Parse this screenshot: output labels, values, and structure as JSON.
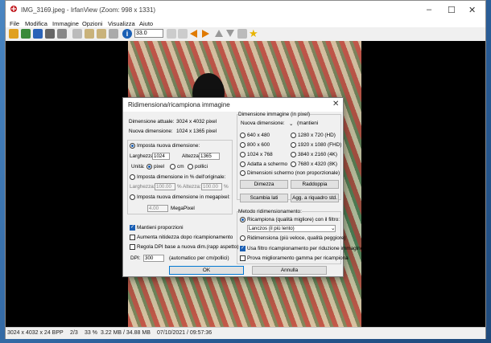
{
  "window": {
    "title": "IMG_3169.jpeg - IrfanView (Zoom: 998 x 1331)",
    "minimize": "–",
    "maximize": "☐",
    "close": "✕"
  },
  "menu": [
    "File",
    "Modifica",
    "Immagine",
    "Opzioni",
    "Visualizza",
    "Aiuto"
  ],
  "toolbar": {
    "zoom_value": "33.0",
    "icons": [
      "open-folder-icon",
      "slideshow-icon",
      "save-icon",
      "print-icon",
      "delete-icon",
      "cut-icon",
      "copy-icon",
      "paste-icon",
      "info-icon",
      "zoom-in-icon",
      "zoom-out-icon",
      "prev-icon",
      "next-icon",
      "first-icon",
      "last-icon",
      "tools-icon",
      "star-icon"
    ]
  },
  "status": {
    "dims": "3024 x 4032 x 24 BPP",
    "index": "2/3",
    "zoom": "33 %",
    "size": "3.22 MB / 34.88 MB",
    "datetime": "07/10/2021 / 09:57:36"
  },
  "dialog": {
    "title": "Ridimensiona/ricampiona immagine",
    "close": "✕",
    "current_dim_label": "Dimensione attuale:",
    "current_dim_value": "3024  x  4032  pixel",
    "new_dim_label": "Nuova dimensione:",
    "new_dim_value": "1024  x  1365  pixel",
    "set_new_size": "Imposta nuova dimensione:",
    "width_label": "Larghezza:",
    "width_value": "1024",
    "height_label": "Altezza:",
    "height_value": "1365",
    "units_label": "Unità:",
    "unit_pixel": "pixel",
    "unit_cm": "cm",
    "unit_inch": "pollici",
    "set_percent": "Imposta dimensione in % dell'originale:",
    "pct_width_label": "Larghezza:",
    "pct_width_value": "100.00",
    "pct_height_label": "Altezza:",
    "pct_height_value": "100.00",
    "pct_sign": "%",
    "set_megapixel": "Imposta nuova dimensione in megapixel:",
    "megapixel_value": "4.00",
    "megapixel_unit": "MegaPixel",
    "keep_proportions": "Mantieni proporzioni",
    "sharpen": "Aumenta nitidezza dopo ricampionamento",
    "adjust_dpi": "Regola DPI base a nuova dim.(rapp aspetto)",
    "dpi_label": "DPI:",
    "dpi_value": "300",
    "dpi_note": "(automatico per cm/pollici)",
    "ok": "OK",
    "cancel": "Annulla",
    "image_size_group": "Dimensione immagine (in pixel)",
    "new_size_dropdown_label": "Nuova dimensione:",
    "keep_label": "(mantieni",
    "presets": [
      "640 x 480",
      "800 x 600",
      "1024 x 768",
      "Adatta a schermo",
      "1280 x 720  (HD)",
      "1920 x 1080 (FHD)",
      "3840 x 2160 (4K)",
      "7680 x 4320 (8K)"
    ],
    "screen_dims": "Dimensioni schermo (non proporzionale)",
    "halve": "Dimezza",
    "double": "Raddoppia",
    "swap": "Scambia lati",
    "square": "Agg. a riquadro std.",
    "method_group": "Metodo ridimensionamento:",
    "resample": "Ricampiona (qualità migliore) con il filtro:",
    "filter_value": "Lanczos (il più lento)",
    "resize": "Ridimensiona (più veloce, qualità peggiore)",
    "use_filter": "Usa filtro ricampionamento per riduzione immagine",
    "gamma": "Prova miglioramento gamma per ricampiona"
  }
}
